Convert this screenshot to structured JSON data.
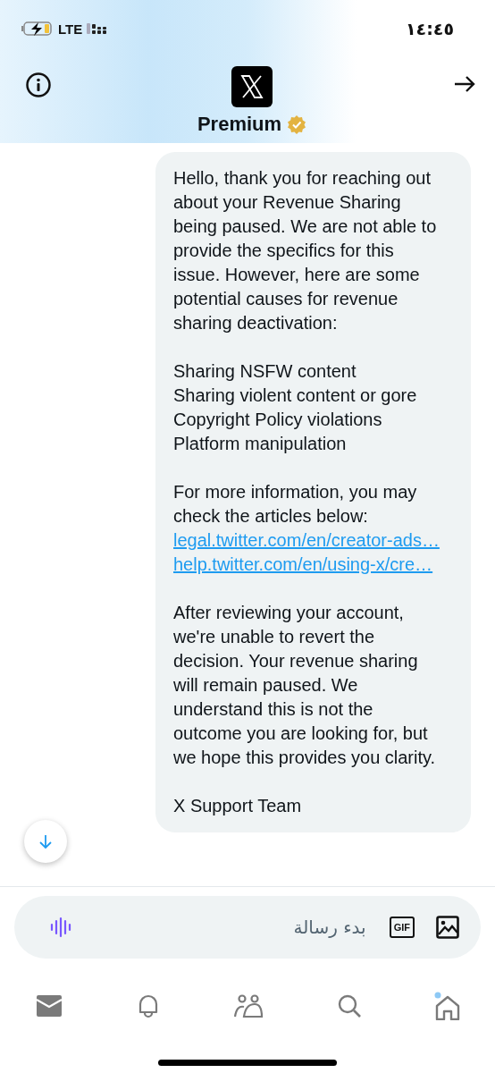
{
  "status_bar": {
    "network": "LTE",
    "time": "١٤:٤٥"
  },
  "header": {
    "title": "Premium"
  },
  "message": {
    "sections": [
      {
        "lines": [
          {
            "kind": "text",
            "text": "Hello, thank you for reaching out about your Revenue Sharing being paused. We are not able to provide the specifics for this issue. However, here are some potential causes for revenue sharing deactivation:"
          }
        ]
      },
      {
        "lines": [
          {
            "kind": "text",
            "text": "Sharing NSFW content"
          },
          {
            "kind": "text",
            "text": "Sharing violent content or gore"
          },
          {
            "kind": "text",
            "text": "Copyright Policy violations"
          },
          {
            "kind": "text",
            "text": "Platform manipulation"
          }
        ]
      },
      {
        "lines": [
          {
            "kind": "text",
            "text": "For more information, you may check the articles below:"
          },
          {
            "kind": "link",
            "text": "legal.twitter.com/en/creator-ads…"
          },
          {
            "kind": "link",
            "text": "help.twitter.com/en/using-x/cre…"
          }
        ]
      },
      {
        "lines": [
          {
            "kind": "text",
            "text": "After reviewing your account, we're unable to revert the decision. Your revenue sharing will remain paused. We understand this is not the outcome you are looking for, but we hope this provides you clarity."
          }
        ]
      },
      {
        "lines": [
          {
            "kind": "text",
            "text": "X Support Team"
          }
        ]
      }
    ]
  },
  "composer": {
    "placeholder": "بدء رسالة",
    "gif_label": "GIF"
  }
}
